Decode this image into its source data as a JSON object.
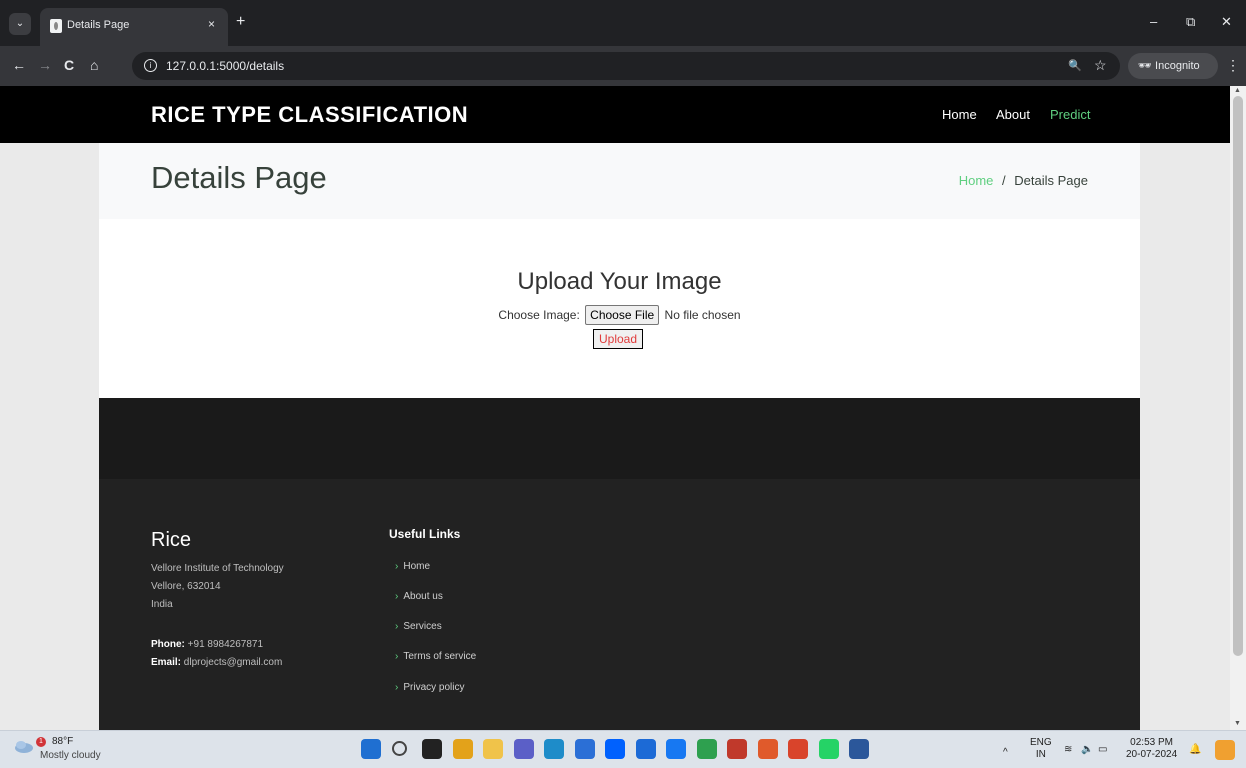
{
  "browser": {
    "tab_title": "Details Page",
    "tab_close": "×",
    "new_tab": "+",
    "tab_dropdown": "⌄",
    "url": "127.0.0.1:5000/details",
    "incognito_label": "Incognito",
    "nav_back": "←",
    "nav_forward": "→",
    "nav_reload": "C",
    "nav_home": "⌂",
    "window_minimize": "–",
    "window_restore": "⧉",
    "window_close": "✕",
    "zoom_icon": "🔍",
    "star_icon": "☆",
    "kebab": "⋮"
  },
  "site": {
    "brand": "RICE TYPE CLASSIFICATION",
    "nav": [
      {
        "label": "Home"
      },
      {
        "label": "About"
      },
      {
        "label": "Predict"
      }
    ],
    "breadcrumb": {
      "title": "Details Page",
      "home": "Home",
      "separator": "/",
      "current": "Details Page"
    },
    "upload": {
      "heading": "Upload Your Image",
      "choose_label": "Choose Image:",
      "file_button": "Choose File",
      "file_status": "No file chosen",
      "submit": "Upload"
    },
    "footer": {
      "brand": "Rice",
      "address_line1": "Vellore Institute of Technology",
      "address_line2": "Vellore, 632014",
      "address_line3": "India",
      "phone_label": "Phone:",
      "phone_value": "+91 8984267871",
      "email_label": "Email:",
      "email_value": "dlprojects@gmail.com",
      "links_title": "Useful Links",
      "links": [
        {
          "label": "Home"
        },
        {
          "label": "About us"
        },
        {
          "label": "Services"
        },
        {
          "label": "Terms of service"
        },
        {
          "label": "Privacy policy"
        }
      ]
    }
  },
  "taskbar": {
    "weather_temp": "88°F",
    "weather_desc": "Mostly cloudy",
    "weather_badge": "1",
    "lang_line1": "ENG",
    "lang_line2": "IN",
    "time": "02:53 PM",
    "date": "20-07-2024",
    "apps": [
      {
        "name": "start-icon",
        "color": "#1f6fd1"
      },
      {
        "name": "search-icon",
        "color": "#444"
      },
      {
        "name": "task-view-icon",
        "color": "#222"
      },
      {
        "name": "chrome-icon",
        "color": "#e3a21a"
      },
      {
        "name": "file-explorer-icon",
        "color": "#f0c34a"
      },
      {
        "name": "teams-icon",
        "color": "#5b5fc7"
      },
      {
        "name": "edge-icon",
        "color": "#1e8cc9"
      },
      {
        "name": "store-icon",
        "color": "#2b6fd6"
      },
      {
        "name": "dropbox-icon",
        "color": "#0061fe"
      },
      {
        "name": "calculator-icon",
        "color": "#1c6ad6"
      },
      {
        "name": "messenger-icon",
        "color": "#1778f2"
      },
      {
        "name": "circle-app-icon",
        "color": "#2ea04f"
      },
      {
        "name": "snipping-tool-icon",
        "color": "#c0392b"
      },
      {
        "name": "chrome-profile-1-icon",
        "color": "#e05a2b"
      },
      {
        "name": "chrome-profile-2-icon",
        "color": "#d9442b"
      },
      {
        "name": "whatsapp-icon",
        "color": "#25d366"
      },
      {
        "name": "word-icon",
        "color": "#2b579a"
      }
    ]
  },
  "colors": {
    "accent": "#5fcf80",
    "upload_text": "#e03b3b",
    "nav_bg": "#000000",
    "footer_bg": "#222222"
  }
}
